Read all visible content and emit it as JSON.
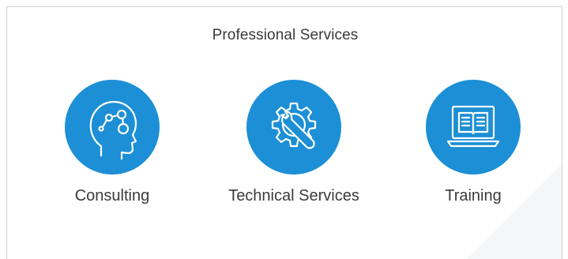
{
  "title": "Professional Services",
  "accent_color": "#1c8fd6",
  "services": [
    {
      "label": "Consulting",
      "icon": "head-with-nodes-icon"
    },
    {
      "label": "Technical Services",
      "icon": "gear-wrench-icon"
    },
    {
      "label": "Training",
      "icon": "laptop-book-icon"
    }
  ]
}
